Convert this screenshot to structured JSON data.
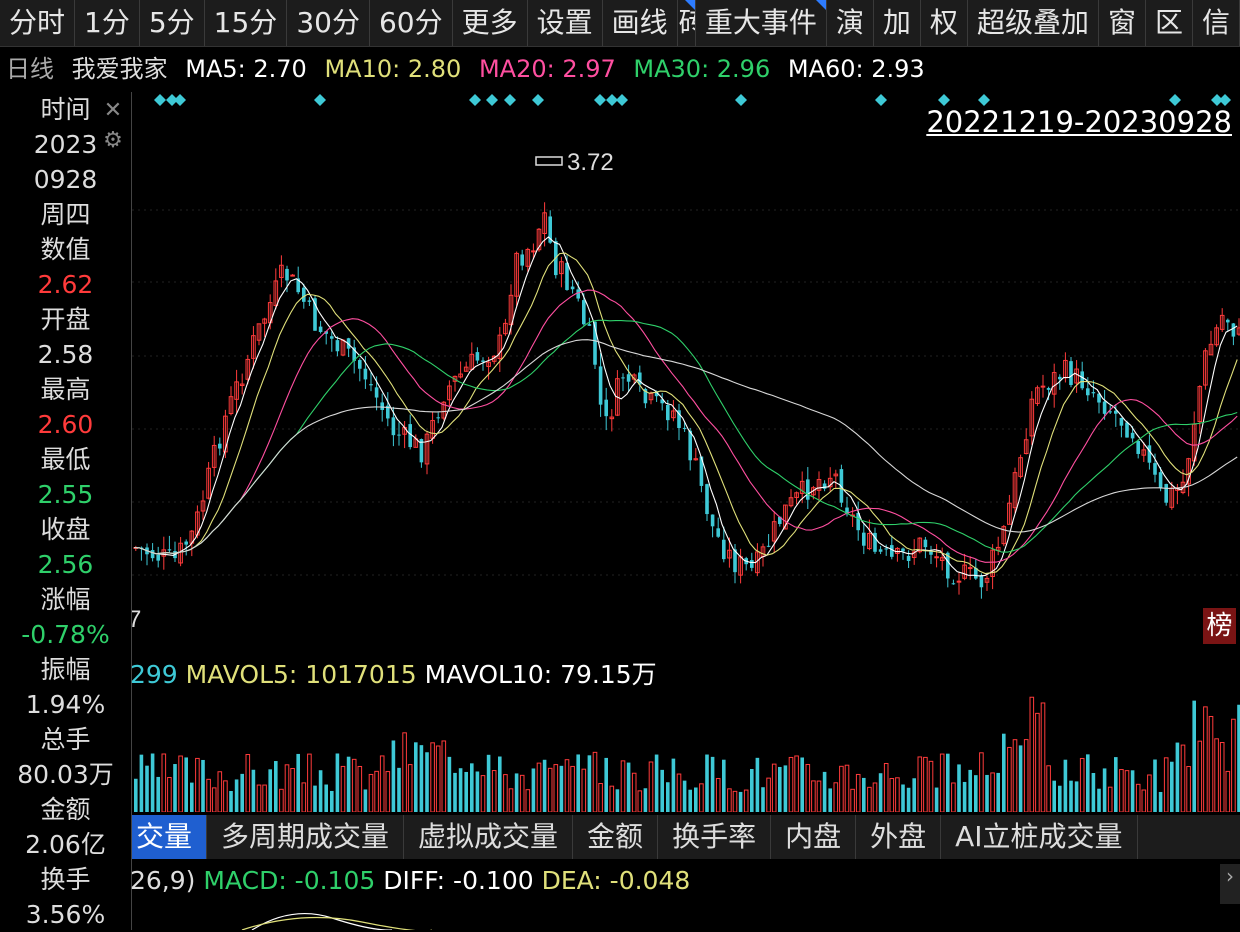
{
  "toolbar": {
    "tabs": [
      "分时",
      "1分",
      "5分",
      "15分",
      "30分",
      "60分",
      "更多",
      "设置",
      "画线",
      "砖",
      "重大事件",
      "演",
      "加",
      "权",
      "超级叠加",
      "窗",
      "区",
      "信"
    ]
  },
  "ma_bar": {
    "period": "日线",
    "name": "我爱我家",
    "ma5": "MA5: 2.70",
    "ma10": "MA10: 2.80",
    "ma20": "MA20: 2.97",
    "ma30": "MA30: 2.96",
    "ma60": "MA60: 2.93",
    "colors": {
      "ma5": "#ffffff",
      "ma10": "#e0e07a",
      "ma20": "#ff4fa0",
      "ma30": "#2fd06a",
      "ma60": "#ffffff"
    }
  },
  "sidebar": {
    "time_label": "时间",
    "year": "2023",
    "date": "0928",
    "weekday": "周四",
    "value_label": "数值",
    "value": "2.62",
    "open_label": "开盘",
    "open": "2.58",
    "high_label": "最高",
    "high": "2.60",
    "low_label": "最低",
    "low": "2.55",
    "close_label": "收盘",
    "close": "2.56",
    "change_label": "涨幅",
    "change": "-0.78%",
    "amplitude_label": "振幅",
    "amplitude": "1.94%",
    "total_hands_label": "总手",
    "total_hands": "80.03万",
    "amount_label": "金额",
    "amount": "2.06亿",
    "turnover_label": "换手",
    "turnover": "3.56%"
  },
  "chart": {
    "range": "20221219-20230928",
    "peak_label": "3.72",
    "edge_label": "7",
    "bang_label": "榜",
    "colors": {
      "up": "#ff3b3b",
      "down": "#3ec9d6",
      "marker": "#3ec9d6"
    }
  },
  "volume": {
    "prefix": "299",
    "mavol5": "MAVOL5: 1017015",
    "mavol10": "MAVOL10: 79.15万"
  },
  "indicator_tabs": [
    "交量",
    "多周期成交量",
    "虚拟成交量",
    "金额",
    "换手率",
    "内盘",
    "外盘",
    "AI立桩成交量"
  ],
  "macd": {
    "prefix": "26,9)",
    "macd": "MACD: -0.105",
    "diff": "DIFF: -0.100",
    "dea": "DEA: -0.048"
  }
}
